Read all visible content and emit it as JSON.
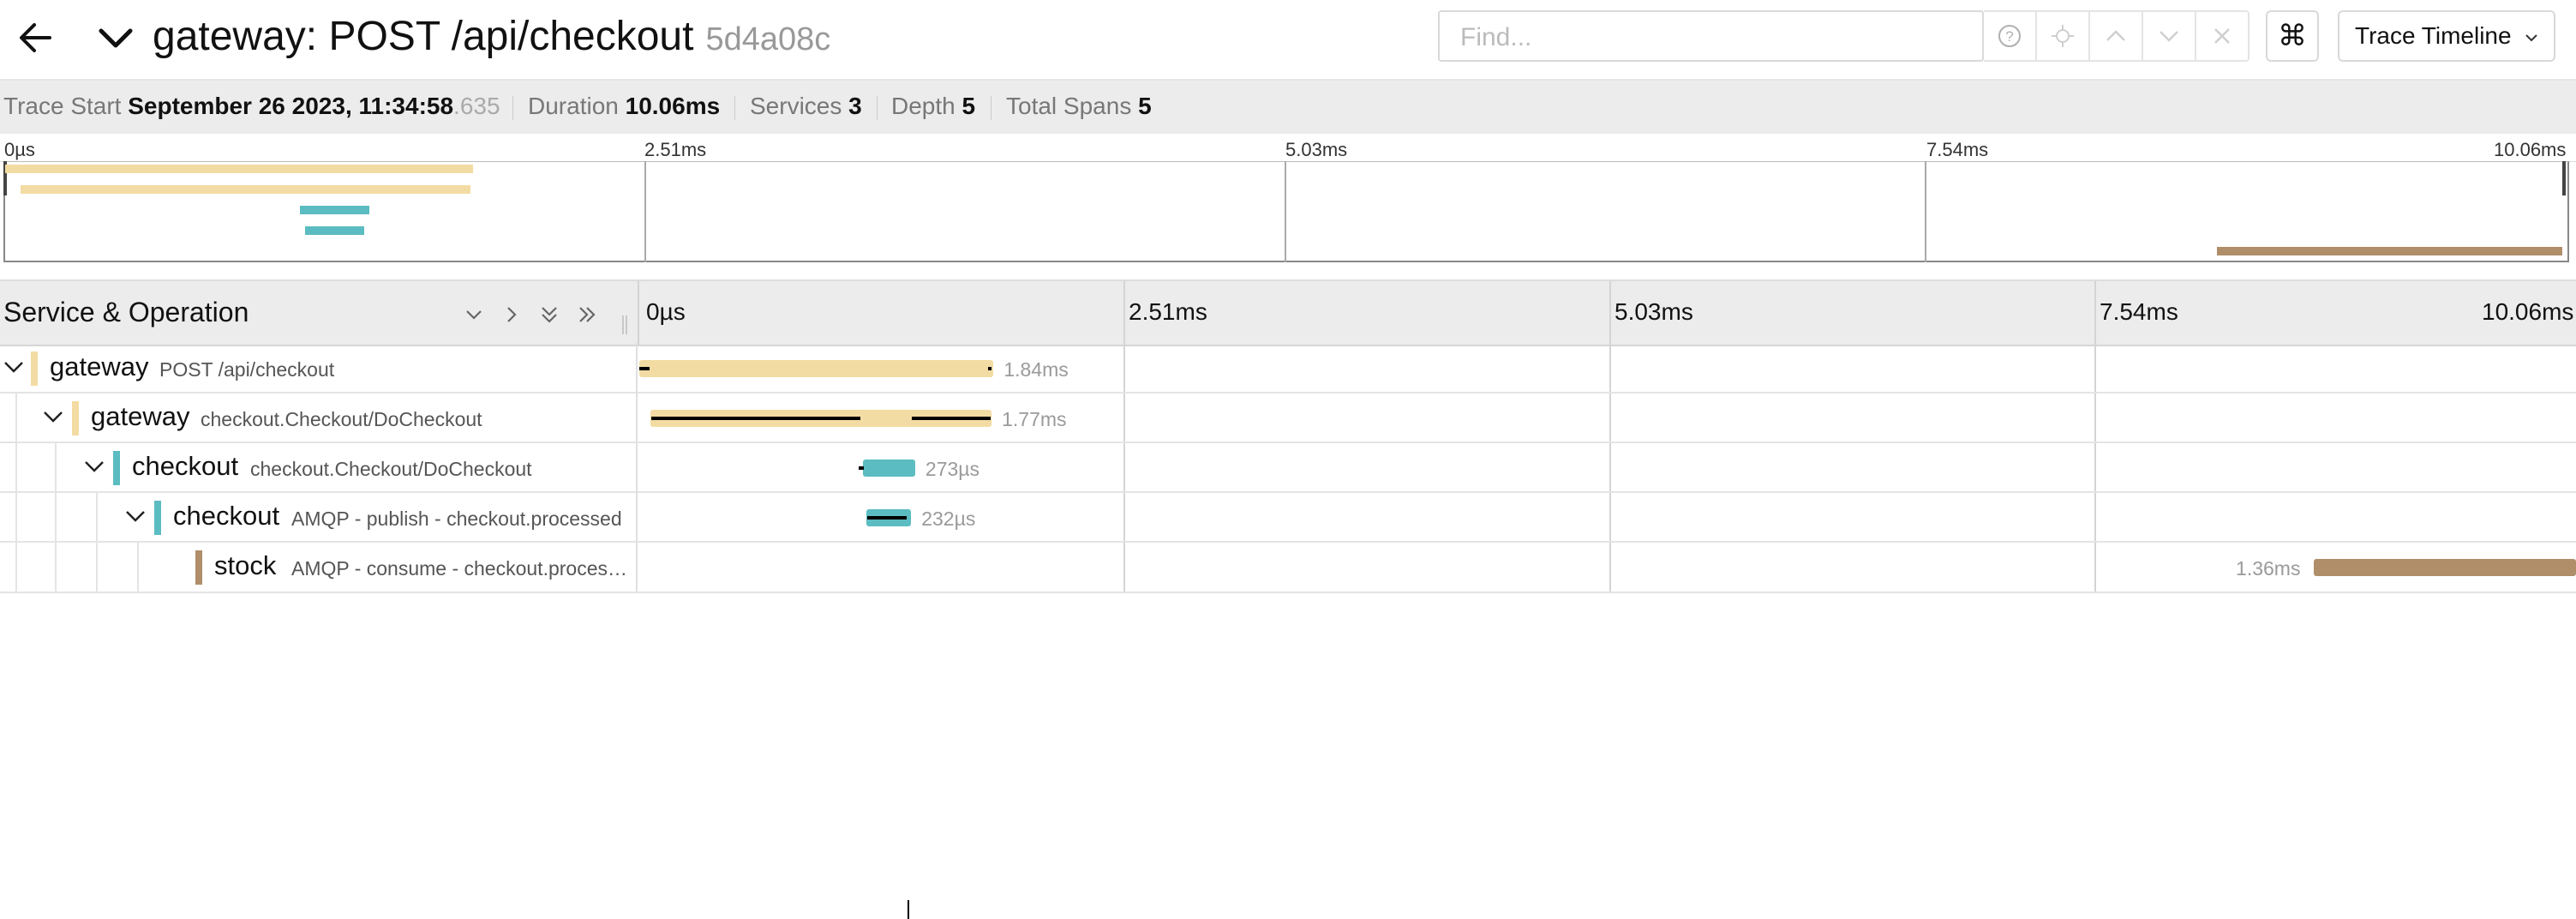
{
  "header": {
    "title": "gateway: POST /api/checkout",
    "trace_id": "5d4a08c",
    "find_placeholder": "Find...",
    "cmd_symbol": "⌘",
    "view_label": "Trace Timeline"
  },
  "stats": {
    "trace_start_label": "Trace Start",
    "trace_start_value": "September 26 2023, 11:34:58",
    "trace_start_ms": ".635",
    "duration_label": "Duration",
    "duration_value": "10.06ms",
    "services_label": "Services",
    "services_value": "3",
    "depth_label": "Depth",
    "depth_value": "5",
    "total_spans_label": "Total Spans",
    "total_spans_value": "5"
  },
  "minimap": {
    "ticks": [
      "0µs",
      "2.51ms",
      "5.03ms",
      "7.54ms",
      "10.06ms"
    ]
  },
  "timeline": {
    "service_operation_label": "Service & Operation",
    "ticks": [
      "0µs",
      "2.51ms",
      "5.03ms",
      "7.54ms",
      "10.06ms"
    ],
    "total_ms": 10.06
  },
  "colors": {
    "gateway": "#f3dca3",
    "checkout": "#5bbcc1",
    "stock": "#b08e6a"
  },
  "spans": [
    {
      "service": "gateway",
      "operation": "POST /api/checkout",
      "duration": "1.84ms",
      "start_ms": 0.0,
      "dur_ms": 1.84,
      "depth": 0,
      "color": "#f3dca3"
    },
    {
      "service": "gateway",
      "operation": "checkout.Checkout/DoCheckout",
      "duration": "1.77ms",
      "start_ms": 0.06,
      "dur_ms": 1.77,
      "depth": 1,
      "color": "#f3dca3"
    },
    {
      "service": "checkout",
      "operation": "checkout.Checkout/DoCheckout",
      "duration": "273µs",
      "start_ms": 1.16,
      "dur_ms": 0.273,
      "depth": 2,
      "color": "#5bbcc1"
    },
    {
      "service": "checkout",
      "operation": "AMQP - publish - checkout.processed",
      "duration": "232µs",
      "start_ms": 1.18,
      "dur_ms": 0.232,
      "depth": 3,
      "color": "#5bbcc1"
    },
    {
      "service": "stock",
      "operation": "AMQP - consume - checkout.processed",
      "duration": "1.36ms",
      "start_ms": 8.7,
      "dur_ms": 1.36,
      "depth": 4,
      "color": "#b08e6a"
    }
  ]
}
